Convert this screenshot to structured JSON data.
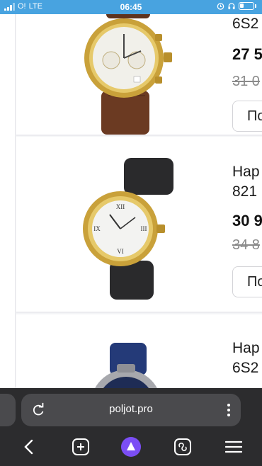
{
  "status_bar": {
    "carrier": "O!",
    "network": "LTE",
    "time": "06:45"
  },
  "products": [
    {
      "name_line2": "6S2",
      "price": "27 5",
      "old_price": "31 0",
      "buy_label": "По",
      "dial_color": "#f1f0ea",
      "strap_color": "#6b3a22"
    },
    {
      "name_line1": "Нар",
      "name_line2": "821",
      "price": "30 9",
      "old_price": "34 8",
      "buy_label": "По",
      "dial_color": "#f3f3f1",
      "strap_color": "#2a2a2c"
    },
    {
      "name_line1": "Нар",
      "name_line2": "6S2",
      "dial_color": "#1e2c55",
      "strap_color": "#243a78"
    }
  ],
  "browser": {
    "url": "poljot.pro",
    "accent": "#7b4ef5",
    "icons": [
      "back-icon",
      "new-tab-icon",
      "assistant-icon",
      "tabs-icon",
      "menu-icon"
    ]
  }
}
